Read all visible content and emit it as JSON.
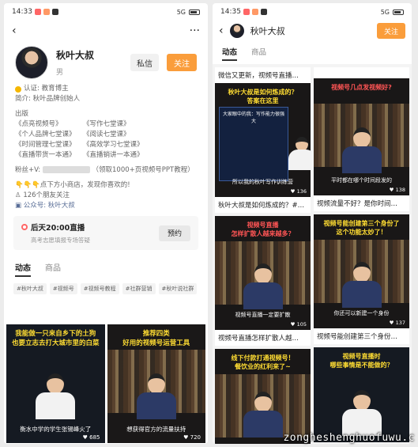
{
  "left": {
    "status_time": "14:33",
    "status_right": "5G",
    "more_label": "···",
    "name": "秋叶大叔",
    "gender": "男",
    "btn_message": "私信",
    "btn_follow": "关注",
    "cert": "认证: 教育博主",
    "intro": "简介: 秋叶品牌创始人",
    "publish_label": "出版",
    "books": [
      "《点亮视频号》",
      "《写作七堂课》",
      "《个人品牌七堂课》",
      "《阅读七堂课》",
      "《时间管理七堂课》",
      "《高效学习七堂课》",
      "《直播带货一本通》",
      "《直播销讲一本通》"
    ],
    "fans_prefix": "粉丝+V:",
    "fans_suffix": "（领取1000+页视频号PPT教程）",
    "shop": "👇👇👇点下方小商店，发现你喜欢的!",
    "friends": "126个朋友关注",
    "official": "公众号: 秋叶大叔",
    "live_title": "后天20:00直播",
    "live_sub": "高考志愿填报专场答疑",
    "live_btn": "预约",
    "tab_dynamic": "动态",
    "tab_goods": "商品",
    "tags": [
      "#秋叶大叔",
      "#视频号",
      "#视频号教程",
      "#社群营销",
      "#秋叶说社群"
    ],
    "videos": [
      {
        "headline": "我能做一只来自乡下的土狗\n也要立志去打大城市里的白菜",
        "caption": "衡水中学的学生张锡峰火了",
        "likes": "685"
      },
      {
        "headline": "推荐四类\n好用的视频号运营工具",
        "caption": "想获得官方的流量扶持",
        "likes": "720"
      }
    ]
  },
  "right": {
    "status_time": "14:35",
    "status_right": "5G",
    "name": "秋叶大叔",
    "btn_follow": "关注",
    "tab_dynamic": "动态",
    "tab_goods": "商品",
    "top_title": "微信又更新，视频号直播…",
    "col_left": [
      {
        "headline": "秋叶大叔是如何炼成的？\n答案在这里",
        "caption": "所以我的秋叶写作训练营",
        "likes": "136",
        "slide_text": "大家眼中的我：写作能力很强大",
        "title": "秋叶大叔是如何炼成的？#…"
      },
      {
        "headline": "视频号直播\n怎样扩散人越来越多？",
        "caption": "视频号直播一定要扩散",
        "likes": "105",
        "title": "视频号直播怎样扩散人越…"
      },
      {
        "headline": "线下付款打通视频号！\n餐饮业的红利来了~",
        "caption": "",
        "likes": "",
        "title": ""
      }
    ],
    "col_right": [
      {
        "headline": "视频号几点发视频好?",
        "caption": "平时都在哪个时间段发的",
        "likes": "138",
        "title": "视频流量不好？是你时间…"
      },
      {
        "headline": "视频号能创建第三个身份了\n这个功能太妙了！",
        "caption": "你还可以新建一个身份",
        "likes": "137",
        "title": "视频号能创建第三个身份…"
      },
      {
        "headline": "视频号直播时\n哪些事情是不能做的？",
        "caption": "",
        "likes": "",
        "title": ""
      }
    ]
  },
  "watermark": "zongheshenghuofuwu.c"
}
